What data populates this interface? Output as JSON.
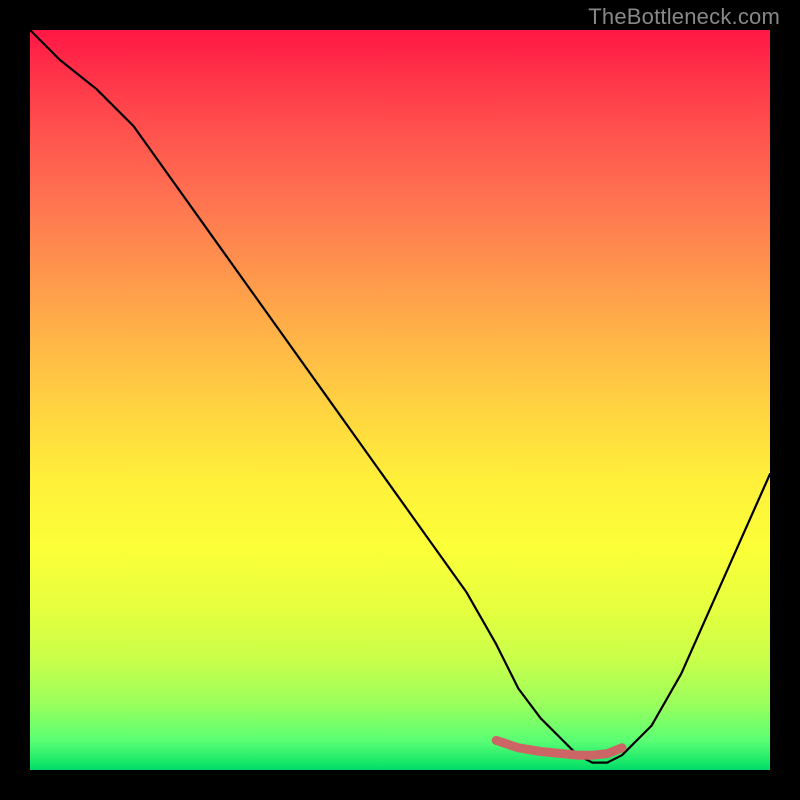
{
  "watermark": "TheBottleneck.com",
  "chart_data": {
    "type": "line",
    "title": "",
    "xlabel": "",
    "ylabel": "",
    "xlim": [
      0,
      100
    ],
    "ylim": [
      0,
      100
    ],
    "grid": false,
    "legend": false,
    "series": [
      {
        "name": "bottleneck-curve",
        "x": [
          0,
          4,
          9,
          14,
          19,
          24,
          29,
          34,
          39,
          44,
          49,
          54,
          59,
          63,
          66,
          69,
          72,
          74,
          76,
          78,
          80,
          84,
          88,
          92,
          96,
          100
        ],
        "values": [
          100,
          96,
          92,
          87,
          80,
          73,
          66,
          59,
          52,
          45,
          38,
          31,
          24,
          17,
          11,
          7,
          4,
          2,
          1,
          1,
          2,
          6,
          13,
          22,
          31,
          40
        ]
      },
      {
        "name": "highlight-segment",
        "x": [
          63,
          66,
          69,
          72,
          74,
          76,
          78,
          80
        ],
        "values": [
          4.0,
          3.0,
          2.5,
          2.2,
          2.0,
          2.0,
          2.2,
          3.0
        ]
      }
    ],
    "background_gradient_stops": [
      {
        "pct": 0,
        "hex": "#ff1744"
      },
      {
        "pct": 8,
        "hex": "#ff3b4a"
      },
      {
        "pct": 16,
        "hex": "#ff5a4f"
      },
      {
        "pct": 25,
        "hex": "#ff7a50"
      },
      {
        "pct": 34,
        "hex": "#ff9a4c"
      },
      {
        "pct": 43,
        "hex": "#ffb946"
      },
      {
        "pct": 52,
        "hex": "#ffd640"
      },
      {
        "pct": 61,
        "hex": "#fff03a"
      },
      {
        "pct": 70,
        "hex": "#fbff38"
      },
      {
        "pct": 78,
        "hex": "#e6ff3e"
      },
      {
        "pct": 85,
        "hex": "#c9ff4a"
      },
      {
        "pct": 91,
        "hex": "#9bff5c"
      },
      {
        "pct": 96,
        "hex": "#5aff74"
      },
      {
        "pct": 99,
        "hex": "#17e86a"
      },
      {
        "pct": 100,
        "hex": "#00d86a"
      }
    ],
    "colors": {
      "curve": "#000000",
      "highlight": "#cc6666",
      "frame": "#000000"
    }
  }
}
